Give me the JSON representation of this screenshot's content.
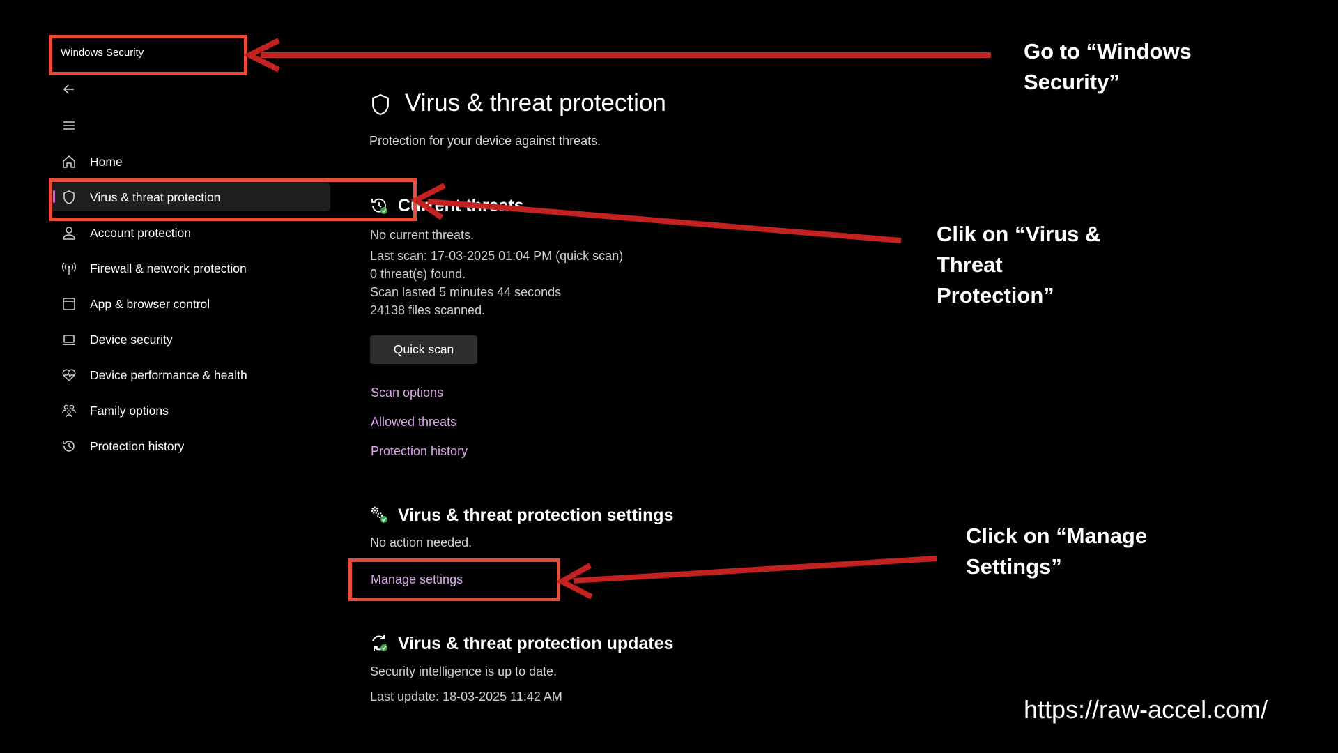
{
  "window": {
    "title": "Windows Security"
  },
  "sidebar": {
    "items": [
      {
        "label": "Home",
        "icon": "home-icon"
      },
      {
        "label": "Virus & threat protection",
        "icon": "shield-icon"
      },
      {
        "label": "Account protection",
        "icon": "person-icon"
      },
      {
        "label": "Firewall & network protection",
        "icon": "antenna-icon"
      },
      {
        "label": "App & browser control",
        "icon": "app-window-icon"
      },
      {
        "label": "Device security",
        "icon": "laptop-icon"
      },
      {
        "label": "Device performance & health",
        "icon": "heart-pulse-icon"
      },
      {
        "label": "Family options",
        "icon": "family-icon"
      },
      {
        "label": "Protection history",
        "icon": "history-icon"
      }
    ],
    "active_index": 1
  },
  "main": {
    "title": "Virus & threat protection",
    "subtitle": "Protection for your device against threats.",
    "current_threats": {
      "title": "Current threats",
      "lines": [
        "No current threats.",
        "Last scan: 17-03-2025 01:04 PM (quick scan)",
        "0 threat(s) found.",
        "Scan lasted 5 minutes 44 seconds",
        "24138 files scanned."
      ],
      "quick_scan_label": "Quick scan",
      "links": [
        "Scan options",
        "Allowed threats",
        "Protection history"
      ]
    },
    "settings": {
      "title": "Virus & threat protection settings",
      "status": "No action needed.",
      "link": "Manage settings"
    },
    "updates": {
      "title": "Virus & threat protection updates",
      "lines": [
        "Security intelligence is up to date.",
        "Last update: 18-03-2025 11:42 AM"
      ]
    }
  },
  "annotations": {
    "step1": [
      "Go to “Windows",
      "Security”"
    ],
    "step2": [
      "Clik on “Virus &",
      "Threat",
      "Protection”"
    ],
    "step3": [
      "Click on “Manage",
      "Settings”"
    ],
    "url": "https://raw-accel.com/"
  },
  "colors": {
    "background": "#000000",
    "annotation_red": "#ea4c3b",
    "arrow_red": "#c42121",
    "link": "#d9a7e8",
    "check_green": "#3aa54a"
  }
}
